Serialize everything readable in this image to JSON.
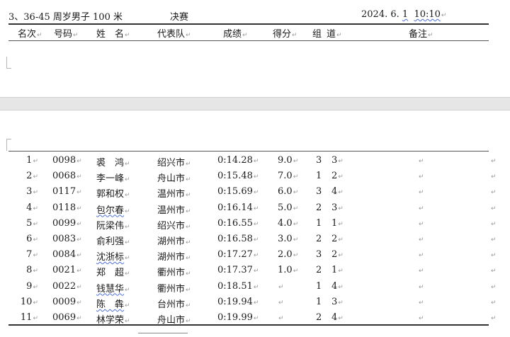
{
  "event": {
    "title_prefix": "3、36-45 ",
    "title_cn": "周岁男子",
    "title_dist": " 100 米",
    "stage": "决赛",
    "date": "2024. 6. ",
    "date_day": "1",
    "time": "10:10"
  },
  "marks": {
    "cell": "↵",
    "para": "↵"
  },
  "headers": {
    "rank": "名次",
    "number": "号码",
    "name": "姓　名",
    "team": "代表队",
    "result": "成绩",
    "score": "得分",
    "group": "组",
    "lane": "道",
    "remark": "备注"
  },
  "rows": [
    {
      "rank": "1",
      "number": "0098",
      "name": "裘　鸿",
      "team": "绍兴市",
      "result": "0:14.28",
      "score": "9.0",
      "group": "3",
      "lane": "3",
      "sq": false
    },
    {
      "rank": "2",
      "number": "0068",
      "name": "李一峰",
      "team": "舟山市",
      "result": "0:15.48",
      "score": "7.0",
      "group": "1",
      "lane": "2",
      "sq": false
    },
    {
      "rank": "3",
      "number": "0117",
      "name": "郭和权",
      "team": "温州市",
      "result": "0:15.69",
      "score": "6.0",
      "group": "3",
      "lane": "4",
      "sq": false
    },
    {
      "rank": "4",
      "number": "0118",
      "name": "包尔春",
      "team": "温州市",
      "result": "0:16.14",
      "score": "5.0",
      "group": "2",
      "lane": "3",
      "sq": true
    },
    {
      "rank": "5",
      "number": "0099",
      "name": "阮梁伟",
      "team": "绍兴市",
      "result": "0:16.55",
      "score": "4.0",
      "group": "1",
      "lane": "1",
      "sq": false
    },
    {
      "rank": "6",
      "number": "0083",
      "name": "俞利强",
      "team": "湖州市",
      "result": "0:16.58",
      "score": "3.0",
      "group": "2",
      "lane": "2",
      "sq": false
    },
    {
      "rank": "7",
      "number": "0084",
      "name": "沈浙标",
      "team": "湖州市",
      "result": "0:17.27",
      "score": "2.0",
      "group": "3",
      "lane": "2",
      "sq": true
    },
    {
      "rank": "8",
      "number": "0021",
      "name": "郑　超",
      "team": "衢州市",
      "result": "0:17.37",
      "score": "1.0",
      "group": "2",
      "lane": "1",
      "sq": false
    },
    {
      "rank": "9",
      "number": "0022",
      "name": "钱慧华",
      "team": "衢州市",
      "result": "0:18.51",
      "score": "",
      "group": "1",
      "lane": "4",
      "sq": true
    },
    {
      "rank": "10",
      "number": "0009",
      "name": "陈　犇",
      "team": "台州市",
      "result": "0:19.94",
      "score": "",
      "group": "1",
      "lane": "3",
      "sq": true
    },
    {
      "rank": "11",
      "number": "0069",
      "name": "林学荣",
      "team": "舟山市",
      "result": "0:19.99",
      "score": "",
      "group": "2",
      "lane": "4",
      "sq": false
    }
  ]
}
